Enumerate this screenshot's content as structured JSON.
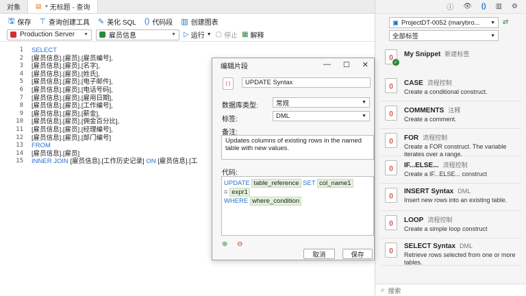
{
  "tabs": [
    {
      "label": "对象",
      "active": false
    },
    {
      "label": "* 无标题 - 查询",
      "active": true
    }
  ],
  "toolbar": {
    "save": "保存",
    "query_builder": "查询创建工具",
    "beautify": "美化 SQL",
    "snippet": "代码段",
    "create_chart": "创建图表"
  },
  "row2": {
    "connection": "Production Server",
    "database": "雇员信息",
    "run": "运行",
    "stop": "停止",
    "explain": "解释",
    "conn_color": "#d32f2f",
    "db_color": "#2a8a3c"
  },
  "editor": {
    "line_numbers": [
      "1",
      "2",
      "3",
      "4",
      "5",
      "6",
      "7",
      "8",
      "9",
      "10",
      "11",
      "12",
      "13",
      "14",
      "15"
    ],
    "lines": [
      [
        {
          "t": "SELECT",
          "k": true
        }
      ],
      [
        {
          "t": "[雇员信息].[雇员].[雇员编号],",
          "k": false
        }
      ],
      [
        {
          "t": "[雇员信息].[雇员].[名字],",
          "k": false
        }
      ],
      [
        {
          "t": "[雇员信息].[雇员].[姓氏],",
          "k": false
        }
      ],
      [
        {
          "t": "[雇员信息].[雇员].[电子邮件],",
          "k": false
        }
      ],
      [
        {
          "t": "[雇员信息].[雇员].[电话号码],",
          "k": false
        }
      ],
      [
        {
          "t": "[雇员信息].[雇员].[雇用日期],",
          "k": false
        }
      ],
      [
        {
          "t": "[雇员信息].[雇员].[工作编号],",
          "k": false
        }
      ],
      [
        {
          "t": "[雇员信息].[雇员].[薪金],",
          "k": false
        }
      ],
      [
        {
          "t": "[雇员信息].[雇员].[佣金百分比],",
          "k": false
        }
      ],
      [
        {
          "t": "[雇员信息].[雇员].[经理编号],",
          "k": false
        }
      ],
      [
        {
          "t": "[雇员信息].[雇员].[部门编号]",
          "k": false
        }
      ],
      [
        {
          "t": "FROM",
          "k": true
        }
      ],
      [
        {
          "t": "[雇员信息].[雇员]",
          "k": false
        }
      ],
      [
        {
          "t": "INNER JOIN",
          "k": true
        },
        {
          "t": " [雇员信息].[工作历史记录] ",
          "k": false
        },
        {
          "t": "ON",
          "k": true
        },
        {
          "t": " [雇员信息].[工",
          "k": false
        }
      ]
    ]
  },
  "right": {
    "project": "ProjectDT-0052 (marybro...",
    "tag_filter": "全部标签",
    "search_placeholder": "搜索",
    "snippets": [
      {
        "title": "My Snippet",
        "tag": "新建标签",
        "desc": "",
        "check": true
      },
      {
        "title": "CASE",
        "tag": "流程控制",
        "desc": "Create a conditional construct."
      },
      {
        "title": "COMMENTS",
        "tag": "注释",
        "desc": "Create a comment."
      },
      {
        "title": "FOR",
        "tag": "流程控制",
        "desc": "Create a FOR construct. The variable iterates over a range."
      },
      {
        "title": "IF...ELSE...",
        "tag": "流程控制",
        "desc": "Create a IF...ELSE... construct"
      },
      {
        "title": "INSERT Syntax",
        "tag": "DML",
        "desc": "Insert new rows into an existing table."
      },
      {
        "title": "LOOP",
        "tag": "流程控制",
        "desc": "Create a simple loop construct"
      },
      {
        "title": "SELECT Syntax",
        "tag": "DML",
        "desc": "Retrieve rows selected from one or more tables."
      }
    ]
  },
  "dialog": {
    "title": "编辑片段",
    "name": "UPDATE Syntax",
    "db_type_label": "数据库类型:",
    "db_type": "常规",
    "tag_label": "标签:",
    "tag": "DML",
    "notes_label": "备注:",
    "notes": "Updates columns of existing rows in the named table with new values.",
    "code_label": "代码:",
    "code": {
      "kw1": "UPDATE",
      "ph1": "table_reference",
      "kw2": "SET",
      "ph2": "col_name1",
      "eq": "=",
      "ph3": "expr1",
      "kw3": "WHERE",
      "ph4": "where_condition"
    },
    "cancel": "取消",
    "save": "保存"
  }
}
